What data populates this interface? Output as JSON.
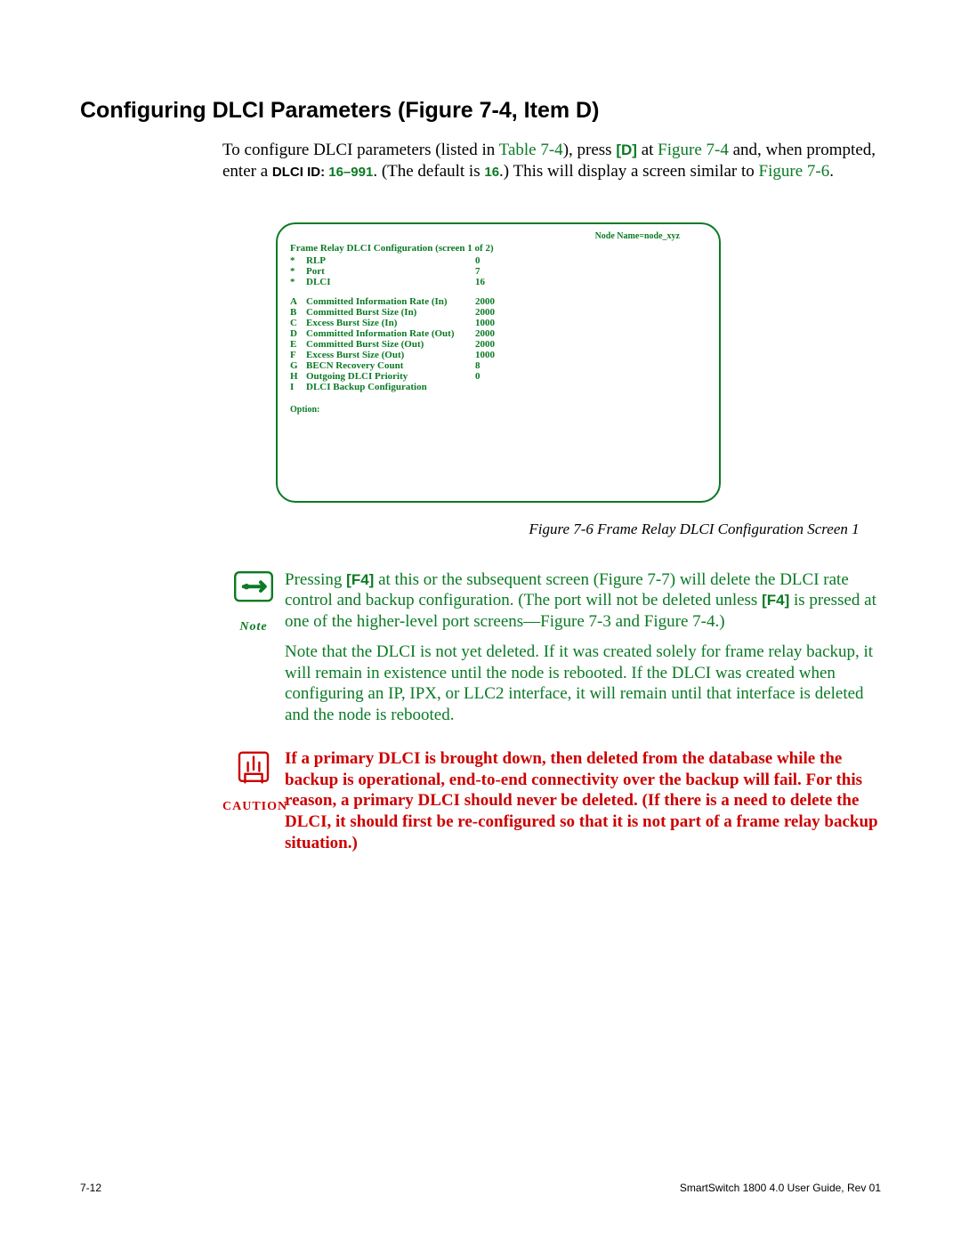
{
  "heading": "Configuring DLCI Parameters (Figure 7-4, Item D)",
  "intro": {
    "t1": "To configure DLCI parameters (listed in ",
    "link1": "Table 7-4",
    "t2": "), press ",
    "key1": "[D]",
    "t3": " at ",
    "link2": "Figure 7-4",
    "t4": " and, when prompted, enter a ",
    "label1": "DLCI ID",
    "colon": ": ",
    "range": "16–991",
    "t5": ". (The default is ",
    "def": "16",
    "t6": ".) This will display a screen similar to ",
    "link3": "Figure 7-6",
    "t7": "."
  },
  "screen": {
    "node": "Node Name=node_xyz",
    "title": "Frame Relay DLCI Configuration (screen 1 of 2)",
    "rows1": [
      {
        "k": "*",
        "l": "RLP",
        "v": "0"
      },
      {
        "k": "*",
        "l": "Port",
        "v": "7"
      },
      {
        "k": "*",
        "l": "DLCI",
        "v": "16"
      }
    ],
    "rows2": [
      {
        "k": "A",
        "l": "Committed Information Rate (In)",
        "v": "2000"
      },
      {
        "k": "B",
        "l": "Committed Burst Size (In)",
        "v": "2000"
      },
      {
        "k": "C",
        "l": "Excess Burst Size (In)",
        "v": "1000"
      },
      {
        "k": "D",
        "l": "Committed Information Rate (Out)",
        "v": "2000"
      },
      {
        "k": "E",
        "l": "Committed Burst Size (Out)",
        "v": "2000"
      },
      {
        "k": "F",
        "l": "Excess Burst Size (Out)",
        "v": "1000"
      },
      {
        "k": "G",
        "l": "BECN Recovery Count",
        "v": "8"
      },
      {
        "k": "H",
        "l": "Outgoing DLCI Priority",
        "v": "0"
      },
      {
        "k": "I",
        "l": "DLCI Backup Configuration",
        "v": ""
      }
    ],
    "option": "Option:"
  },
  "caption": "Figure 7-6    Frame Relay DLCI Configuration Screen 1",
  "note": {
    "label": "Note",
    "p1a": "Pressing ",
    "key": "[F4]",
    "p1b": " at this or the subsequent screen (",
    "link1": "Figure 7-7",
    "p1c": ") will delete the DLCI rate control and backup configuration. (The port will not be deleted unless ",
    "key2": "[F4]",
    "p1d": " is pressed at one of the higher-level port screens—",
    "link2": "Figure 7-3",
    "p1e": " and ",
    "link3": "Figure 7-4",
    "p1f": ".)",
    "p2": "Note that the DLCI is not yet deleted. If it was created solely for frame relay backup, it will remain in existence until the node is rebooted. If the DLCI was created when configuring an IP, IPX, or LLC2 interface, it will remain until that interface is deleted and the node is rebooted."
  },
  "caution": {
    "label": "CAUTION",
    "text": "If a primary DLCI is brought down, then deleted from the database while the backup is operational, end-to-end connectivity over the backup will fail. For this reason, a primary DLCI should never be deleted. (If there is a need to delete the DLCI, it should first be re-configured so that it is not part of a frame relay backup situation.)"
  },
  "footer": {
    "left": "7-12",
    "right": "SmartSwitch 1800 4.0 User Guide, Rev 01"
  }
}
